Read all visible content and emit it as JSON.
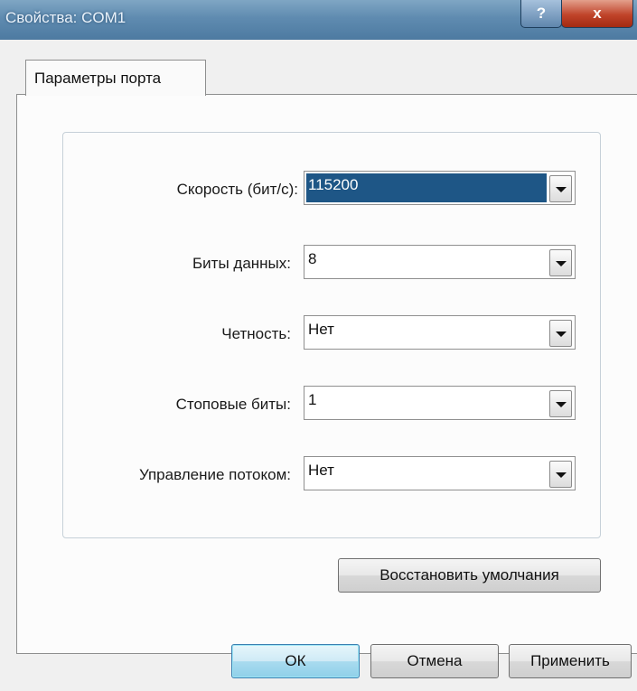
{
  "window": {
    "title": "Свойства: COM1",
    "help_label": "?",
    "close_label": "x"
  },
  "tabs": [
    {
      "label": "Параметры порта",
      "active": true
    }
  ],
  "settings": [
    {
      "label": "Скорость (бит/с):",
      "value": "115200",
      "selected": true
    },
    {
      "label": "Биты данных:",
      "value": "8"
    },
    {
      "label": "Четность:",
      "value": "Нет"
    },
    {
      "label": "Стоповые биты:",
      "value": "1"
    },
    {
      "label": "Управление потоком:",
      "value": "Нет"
    }
  ],
  "restore_button": "Восстановить умолчания",
  "footer": {
    "ok": "ОК",
    "cancel": "Отмена",
    "apply": "Применить"
  },
  "colors": {
    "titlebar": "#5f8bb0",
    "selection": "#1e5686",
    "close_button": "#c0442a",
    "default_button": "#a9dbef"
  }
}
